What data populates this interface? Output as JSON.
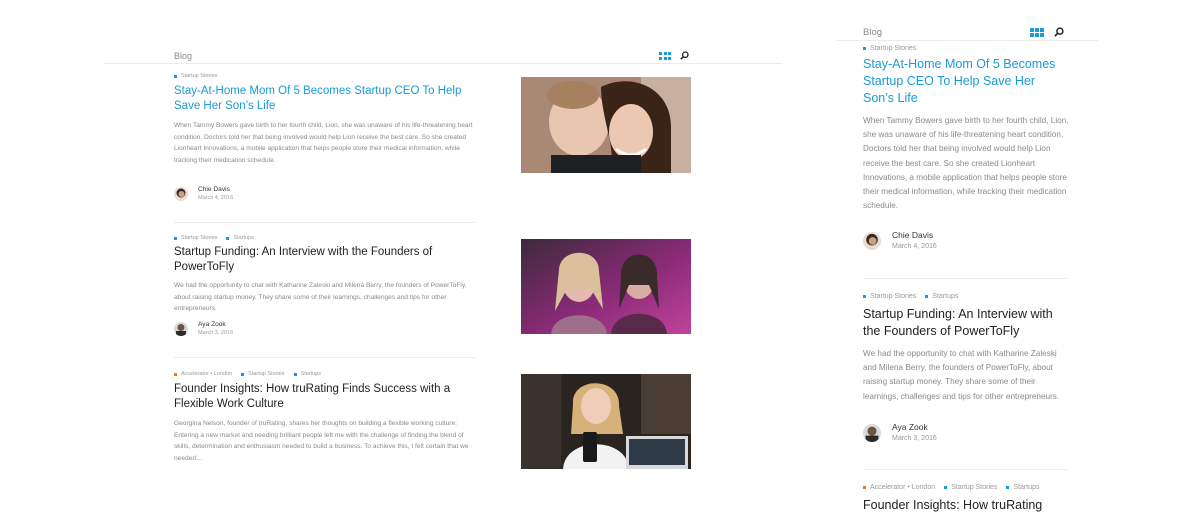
{
  "header": {
    "blog_label": "Blog"
  },
  "colors": {
    "accent": "#1a9bd8",
    "tag_orange": "#f0762c",
    "text": "#222222",
    "muted": "#8a8a8a"
  },
  "icons": {
    "view_toggle": "grid-icon",
    "search": "search-icon"
  },
  "posts": [
    {
      "tags": [
        {
          "label": "Startup Stories",
          "color": "#1a9bd8"
        }
      ],
      "title": "Stay-At-Home Mom Of 5 Becomes Startup CEO To Help Save Her Son’s Life",
      "excerpt": "When Tammy Bowers gave birth to her fourth child, Lion, she was unaware of his life-threatening heart condition. Doctors told her that being involved would help Lion receive the best care. So she created Lionheart Innovations, a mobile application that helps people store their medical information, while tracking their medication schedule.",
      "author": "Chie Davis",
      "date": "March 4, 2016",
      "image": "mother-and-son-photo"
    },
    {
      "tags": [
        {
          "label": "Startup Stories",
          "color": "#1a9bd8"
        },
        {
          "label": "Startups",
          "color": "#1a9bd8"
        }
      ],
      "title": "Startup Funding: An Interview with the Founders of PowerToFly",
      "excerpt": "We had the opportunity to chat with Katharine Zaleski and Milena Berry, the founders of PowerToFly, about raising startup money. They share some of their learnings, challenges and tips for other entrepreneurs.",
      "author": "Aya Zook",
      "date": "March 3, 2016",
      "image": "founders-photo"
    },
    {
      "tags": [
        {
          "label": "Accelerator • London",
          "color": "#f0762c"
        },
        {
          "label": "Startup Stories",
          "color": "#1a9bd8"
        },
        {
          "label": "Startups",
          "color": "#1a9bd8"
        }
      ],
      "title": "Founder Insights: How truRating Finds Success with a Flexible Work Culture",
      "title_cut": "Founder Insights: How truRating",
      "excerpt": "Georgina Nelson, founder of truRating, shares her thoughts on building a flexible working culture: Entering a new market and needing brilliant people left me with the challenge of finding the blend of skills, determination and enthusiasm needed to build a business. To achieve this, I felt certain that we needed…",
      "image": "founder-with-device-photo"
    }
  ]
}
